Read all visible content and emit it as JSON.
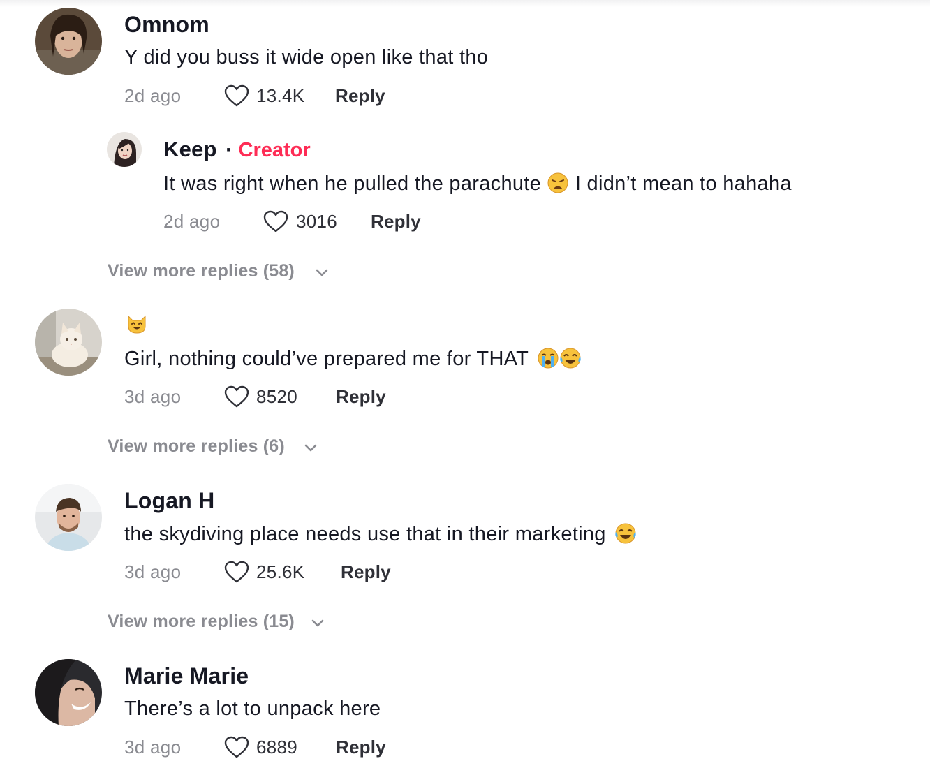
{
  "comments": [
    {
      "username": "Omnom",
      "text": "Y did you buss it wide open like that tho",
      "time": "2d ago",
      "likes": "13.4K",
      "reply_label": "Reply",
      "reply": {
        "username": "Keep",
        "separator": "·",
        "badge": "Creator",
        "text_before": "It was right when he pulled the parachute",
        "text_after": "I didn’t mean to hahaha",
        "emoji": "weary-face-emoji",
        "time": "2d ago",
        "likes": "3016",
        "reply_label": "Reply"
      },
      "view_more": "View more replies (58)"
    },
    {
      "username_emoji": "smiling-cat-emoji",
      "text": "Girl, nothing could’ve prepared me for THAT",
      "emojis": [
        "loudly-crying-face-emoji",
        "tears-of-joy-emoji"
      ],
      "time": "3d ago",
      "likes": "8520",
      "reply_label": "Reply",
      "view_more": "View more replies (6)"
    },
    {
      "username": "Logan H",
      "text": "the skydiving place needs use that in their marketing",
      "emojis": [
        "tears-of-joy-emoji"
      ],
      "time": "3d ago",
      "likes": "25.6K",
      "reply_label": "Reply",
      "view_more": "View more replies (15)"
    },
    {
      "username": "Marie Marie",
      "text": "There’s a lot to unpack here",
      "time": "3d ago",
      "likes": "6889",
      "reply_label": "Reply"
    }
  ],
  "colors": {
    "text": "#161823",
    "meta": "#8a8b91",
    "creator": "#fe2c55"
  },
  "icons": {
    "like": "heart-outline-icon",
    "expand": "chevron-down-icon"
  }
}
